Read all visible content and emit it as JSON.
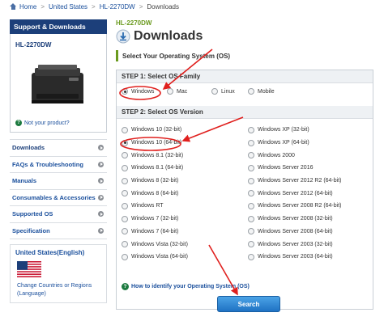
{
  "breadcrumb": {
    "home": "Home",
    "country": "United States",
    "model": "HL-2270DW",
    "current": "Downloads",
    "separator": ">"
  },
  "sidebar": {
    "header": "Support & Downloads",
    "product_name": "HL-2270DW",
    "not_product_link": "Not your product?",
    "menu": [
      {
        "label": "Downloads",
        "active": true
      },
      {
        "label": "FAQs & Troubleshooting",
        "active": false
      },
      {
        "label": "Manuals",
        "active": false
      },
      {
        "label": "Consumables & Accessories",
        "active": false
      },
      {
        "label": "Supported OS",
        "active": false
      },
      {
        "label": "Specification",
        "active": false
      }
    ],
    "region": {
      "title": "United States(English)",
      "change_link": "Change Countries or Regions (Language)"
    }
  },
  "main": {
    "model_tag": "HL-2270DW",
    "title": "Downloads",
    "select_os_heading": "Select Your Operating System (OS)",
    "step1_label": "STEP 1: Select OS Family",
    "os_families": [
      {
        "label": "Windows",
        "checked": true
      },
      {
        "label": "Mac",
        "checked": false
      },
      {
        "label": "Linux",
        "checked": false
      },
      {
        "label": "Mobile",
        "checked": false
      }
    ],
    "step2_label": "STEP 2: Select OS Version",
    "versions_left": [
      {
        "label": "Windows 10 (32-bit)",
        "checked": false
      },
      {
        "label": "Windows 10 (64-bit)",
        "checked": true
      },
      {
        "label": "Windows 8.1 (32-bit)",
        "checked": false
      },
      {
        "label": "Windows 8.1 (64-bit)",
        "checked": false
      },
      {
        "label": "Windows 8 (32-bit)",
        "checked": false
      },
      {
        "label": "Windows 8 (64-bit)",
        "checked": false
      },
      {
        "label": "Windows RT",
        "checked": false
      },
      {
        "label": "Windows 7 (32-bit)",
        "checked": false
      },
      {
        "label": "Windows 7 (64-bit)",
        "checked": false
      },
      {
        "label": "Windows Vista (32-bit)",
        "checked": false
      },
      {
        "label": "Windows Vista (64-bit)",
        "checked": false
      }
    ],
    "versions_right": [
      {
        "label": "Windows XP (32-bit)",
        "checked": false
      },
      {
        "label": "Windows XP (64-bit)",
        "checked": false
      },
      {
        "label": "Windows 2000",
        "checked": false
      },
      {
        "label": "Windows Server 2016",
        "checked": false
      },
      {
        "label": "Windows Server 2012 R2 (64-bit)",
        "checked": false
      },
      {
        "label": "Windows Server 2012 (64-bit)",
        "checked": false
      },
      {
        "label": "Windows Server 2008 R2 (64-bit)",
        "checked": false
      },
      {
        "label": "Windows Server 2008 (32-bit)",
        "checked": false
      },
      {
        "label": "Windows Server 2008 (64-bit)",
        "checked": false
      },
      {
        "label": "Windows Server 2003 (32-bit)",
        "checked": false
      },
      {
        "label": "Windows Server 2003 (64-bit)",
        "checked": false
      }
    ],
    "help_link": "How to identify your Operating System (OS)",
    "search_button": "Search"
  },
  "colors": {
    "navy": "#1c3f7a",
    "link": "#1a4f9c",
    "green": "#6a9a1e",
    "annotation_red": "#e0201e",
    "button_blue": "#1f72c4"
  },
  "icons": [
    "home-icon",
    "download-icon",
    "help-icon",
    "menu-arrow-icon",
    "us-flag-icon",
    "printer-image"
  ]
}
